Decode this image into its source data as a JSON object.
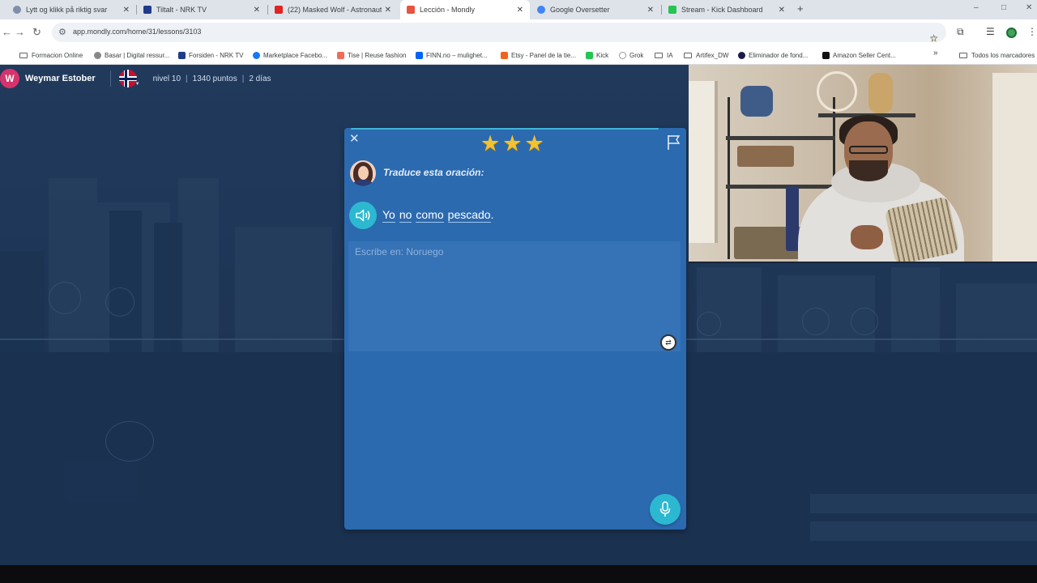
{
  "tabs": [
    {
      "title": "Lytt og klikk på riktig svar",
      "favicon_color": "#7f8fa6"
    },
    {
      "title": "Tiltalt - NRK TV",
      "favicon_color": "#1f3b8a"
    },
    {
      "title": "(22) Masked Wolf - Astronaut",
      "favicon_color": "#e02323"
    },
    {
      "title": "Lección - Mondly",
      "favicon_color": "#e8533f"
    },
    {
      "title": "Google Oversetter",
      "favicon_color": "#4285f4"
    },
    {
      "title": "Stream - Kick Dashboard",
      "favicon_color": "#23c553"
    }
  ],
  "tab_close": "✕",
  "new_tab": "+",
  "window_controls": {
    "minimize": "–",
    "maximize": "□",
    "close": "✕"
  },
  "address": {
    "url": "app.mondly.com/home/31/lessons/3103"
  },
  "bookmarks": [
    {
      "label": "Formacion Online",
      "icon": "folder",
      "color": ""
    },
    {
      "label": "Basar | Digital ressur...",
      "icon": "globe",
      "color": "#888888"
    },
    {
      "label": "Forsiden - NRK TV",
      "icon": "nrk",
      "color": "#1f3b8a"
    },
    {
      "label": "Marketplace Facebo...",
      "icon": "facebook",
      "color": "#1877f2"
    },
    {
      "label": "Tise | Reuse fashion",
      "icon": "tise",
      "color": "#ef6c5a"
    },
    {
      "label": "FINN.no – mulighet...",
      "icon": "finn",
      "color": "#0063fb"
    },
    {
      "label": "Etsy - Panel de la tie...",
      "icon": "etsy",
      "color": "#f1641e"
    },
    {
      "label": "Kick",
      "icon": "kick",
      "color": "#23c553"
    },
    {
      "label": "Grok",
      "icon": "grok",
      "color": "#ffffff"
    },
    {
      "label": "IA",
      "icon": "folder",
      "color": ""
    },
    {
      "label": "Artifex_DW",
      "icon": "folder",
      "color": ""
    },
    {
      "label": "Eliminador de fond...",
      "icon": "remove-bg",
      "color": "#1a1a4a"
    },
    {
      "label": "Amazon Seller Cent...",
      "icon": "amazon",
      "color": "#111111"
    }
  ],
  "bookmarks_more": "»",
  "all_bookmarks": "Todos los marcadores",
  "user": {
    "initial": "W",
    "name": "Weymar Estober",
    "avatar_color": "#d6336c",
    "level": "nivel 10",
    "points": "1340 puntos",
    "days": "2 días"
  },
  "lesson": {
    "close_label": "✕",
    "stars": [
      "★",
      "★",
      "★"
    ],
    "star_color": "#f2c230",
    "instruction": "Traduce esta oración:",
    "sentence_words": [
      "Yo",
      "no",
      "como",
      "pescado"
    ],
    "sentence_end": ".",
    "answer_value": "",
    "answer_placeholder": "Escribe en: Noruego",
    "card_color": "#2b6aaf",
    "accent_color": "#2cb8d0"
  }
}
